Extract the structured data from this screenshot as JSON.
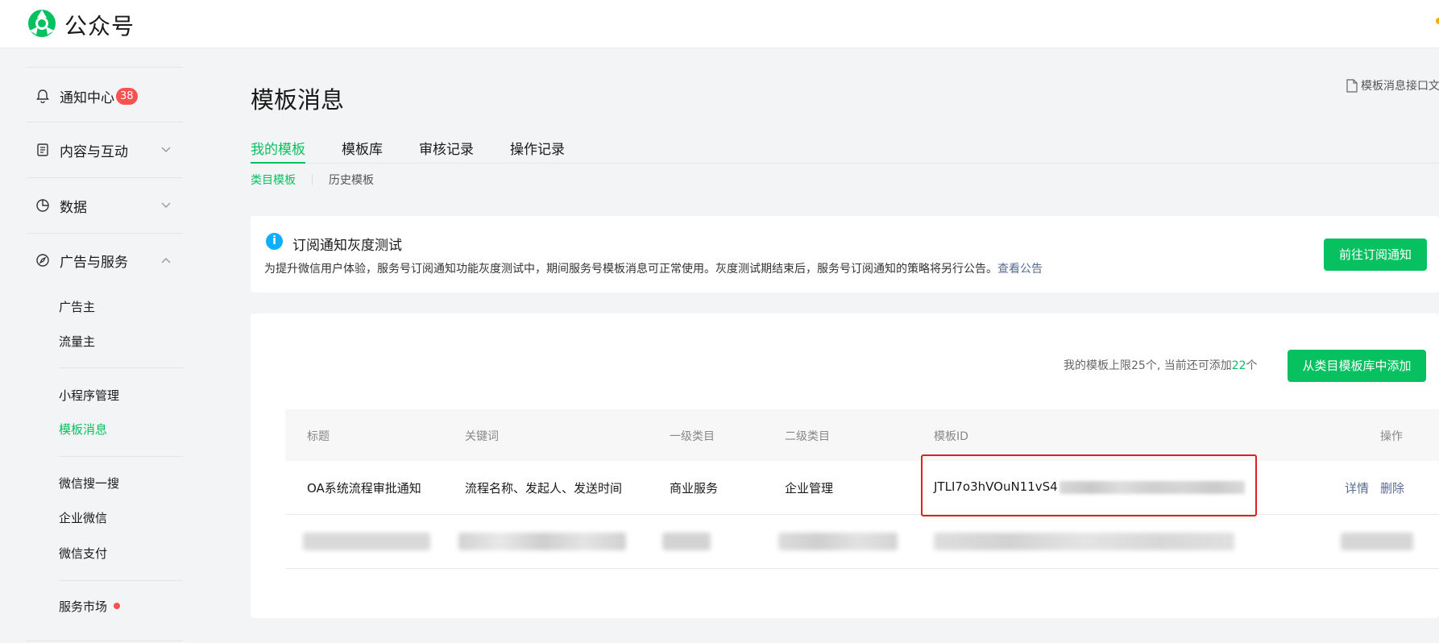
{
  "app": {
    "brand": "公众号"
  },
  "sidebar": {
    "items": [
      {
        "label": "通知中心",
        "badge": "38",
        "icon": "bell-icon"
      },
      {
        "label": "内容与互动",
        "icon": "document-icon"
      },
      {
        "label": "数据",
        "icon": "pie-chart-icon"
      },
      {
        "label": "广告与服务",
        "icon": "compass-icon"
      }
    ],
    "sub_items": {
      "ads": [
        "广告主",
        "流量主"
      ],
      "mini": [
        "小程序管理",
        "模板消息"
      ],
      "other": [
        "微信搜一搜",
        "企业微信",
        "微信支付"
      ],
      "market": "服务市场"
    }
  },
  "main": {
    "title": "模板消息",
    "doc_link": "模板消息接口文",
    "tabs": [
      "我的模板",
      "模板库",
      "审核记录",
      "操作记录"
    ],
    "subtabs": [
      "类目模板",
      "历史模板"
    ],
    "notice": {
      "title": "订阅通知灰度测试",
      "text": "为提升微信用户体验，服务号订阅通知功能灰度测试中，期间服务号模板消息可正常使用。灰度测试期结束后，服务号订阅通知的策略将另行公告。",
      "link": "查看公告",
      "button": "前往订阅通知"
    },
    "limit": {
      "prefix": "我的模板上限25个, 当前还可添加",
      "count": "22",
      "suffix": "个"
    },
    "add_button": "从类目模板库中添加",
    "table": {
      "columns": [
        "标题",
        "关键词",
        "一级类目",
        "二级类目",
        "模板ID",
        "操作"
      ],
      "row1": {
        "title": "OA系统流程审批通知",
        "keywords": "流程名称、发起人、发送时间",
        "category1": "商业服务",
        "category2": "企业管理",
        "template_id": "JTLI7o3hVOuN11vS4",
        "detail": "详情",
        "delete": "删除"
      }
    }
  },
  "colors": {
    "accent": "#07c160",
    "link": "#576b95",
    "badge": "#fa5151",
    "highlight": "#e02020"
  }
}
